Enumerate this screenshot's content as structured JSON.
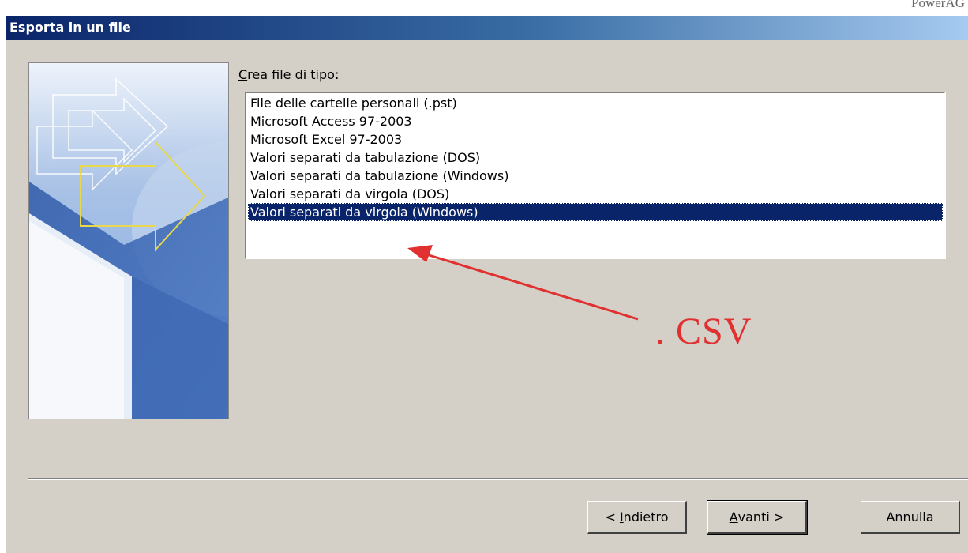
{
  "corner_text": "PowerAG",
  "dialog": {
    "title": "Esporta in un file",
    "list_label_mnemonic": "C",
    "list_label_rest": "rea file di tipo:",
    "file_types": [
      "File delle cartelle personali (.pst)",
      "Microsoft Access 97-2003",
      "Microsoft Excel 97-2003",
      "Valori separati da tabulazione (DOS)",
      "Valori separati da tabulazione (Windows)",
      "Valori separati da virgola (DOS)",
      "Valori separati da virgola (Windows)"
    ],
    "selected_index": 6,
    "buttons": {
      "back_prefix": "< ",
      "back_mnemonic": "I",
      "back_rest": "ndietro",
      "next_mnemonic": "A",
      "next_rest": "vanti >",
      "cancel": "Annulla"
    }
  },
  "annotation": {
    "text": ". CSV",
    "color": "#e03030"
  },
  "colors": {
    "title_bar": "#0a246a",
    "selection": "#0a246a",
    "dialog_bg": "#d4d0c8"
  }
}
